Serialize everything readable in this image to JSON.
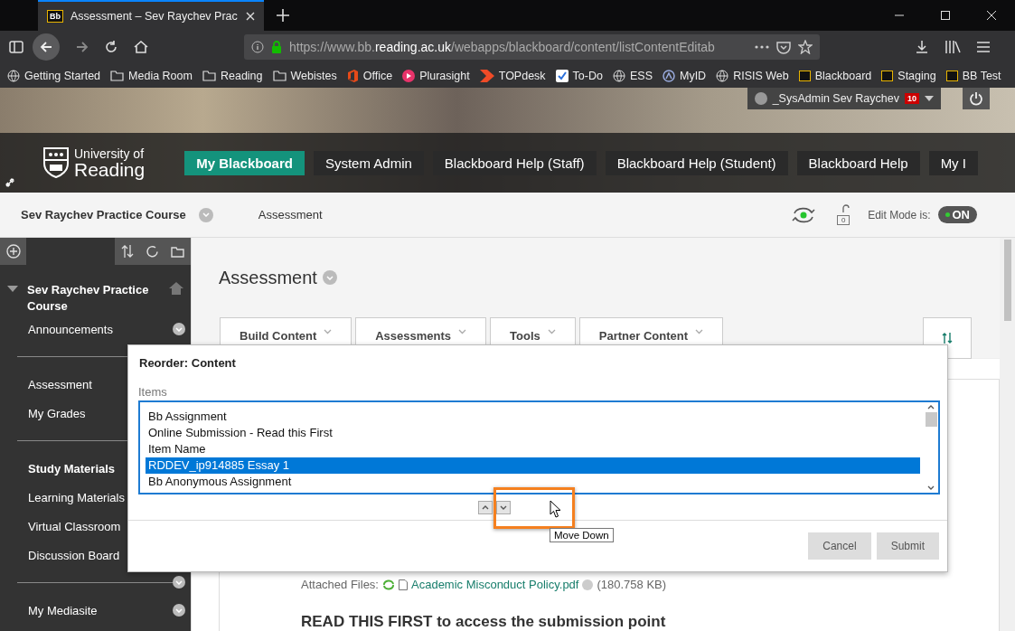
{
  "browser": {
    "tab_icon": "Bb",
    "tab_title": "Assessment – Sev Raychev Prac",
    "url": {
      "prefix": "https://www.bb.",
      "domain": "reading.ac.uk",
      "path": "/webapps/blackboard/content/listContentEditab"
    },
    "bookmarks": [
      {
        "label": "Getting Started",
        "kind": "globe"
      },
      {
        "label": "Media Room",
        "kind": "folder"
      },
      {
        "label": "Reading",
        "kind": "folder"
      },
      {
        "label": "Webistes",
        "kind": "folder"
      },
      {
        "label": "Office",
        "kind": "office"
      },
      {
        "label": "Plurasight",
        "kind": "play"
      },
      {
        "label": "TOPdesk",
        "kind": "arrow"
      },
      {
        "label": "To-Do",
        "kind": "check"
      },
      {
        "label": "ESS",
        "kind": "globe"
      },
      {
        "label": "MyID",
        "kind": "ring"
      },
      {
        "label": "RISIS Web",
        "kind": "globe"
      },
      {
        "label": "Blackboard",
        "kind": "bb"
      },
      {
        "label": "Staging",
        "kind": "bb"
      },
      {
        "label": "BB Test",
        "kind": "bb"
      }
    ]
  },
  "header": {
    "user": "_SysAdmin Sev Raychev",
    "notification_count": "10",
    "logo": [
      "University of",
      "Reading"
    ],
    "tabs": [
      {
        "label": "My Blackboard",
        "selected": true
      },
      {
        "label": "System Admin",
        "selected": false
      },
      {
        "label": "Blackboard Help (Staff)",
        "selected": false
      },
      {
        "label": "Blackboard Help (Student)",
        "selected": false
      },
      {
        "label": "Blackboard Help",
        "selected": false
      },
      {
        "label": "My I",
        "selected": false
      }
    ]
  },
  "course_bar": {
    "course": "Sev Raychev Practice Course",
    "breadcrumb": "Assessment",
    "edit_mode_label": "Edit Mode is:",
    "edit_mode": {
      "on": true,
      "label": "ON"
    },
    "lock_count": "0"
  },
  "sidebar": {
    "items": [
      {
        "kind": "course",
        "label": "Sev Raychev Practice Course"
      },
      {
        "kind": "link",
        "label": "Announcements",
        "menu": true
      },
      {
        "kind": "divider"
      },
      {
        "kind": "link",
        "label": "Assessment",
        "menu": false
      },
      {
        "kind": "link",
        "label": "My Grades",
        "menu": false
      },
      {
        "kind": "divider"
      },
      {
        "kind": "heading",
        "label": "Study Materials"
      },
      {
        "kind": "link",
        "label": "Learning Materials",
        "menu": false
      },
      {
        "kind": "link",
        "label": "Virtual Classroom",
        "menu": false
      },
      {
        "kind": "link",
        "label": "Discussion Board",
        "menu": false
      },
      {
        "kind": "divider",
        "menu": true
      },
      {
        "kind": "link",
        "label": "My Mediasite",
        "menu": true
      }
    ]
  },
  "main": {
    "title": "Assessment",
    "action_buttons": [
      "Build Content",
      "Assessments",
      "Tools",
      "Partner Content"
    ],
    "attached_label": "Attached Files:",
    "file_name": "Academic Misconduct Policy.pdf",
    "file_size": "(180.758 KB)",
    "heading": "READ THIS FIRST to access the submission point"
  },
  "modal": {
    "title": "Reorder: Content",
    "list_label": "Items",
    "items": [
      {
        "label": "Bb Assignment",
        "selected": false
      },
      {
        "label": "Online Submission - Read this First",
        "selected": false
      },
      {
        "label": "Item Name",
        "selected": false
      },
      {
        "label": "RDDEV_ip914885 Essay 1",
        "selected": true
      },
      {
        "label": "Bb Anonymous Assignment",
        "selected": false
      }
    ],
    "tooltip": "Move Down",
    "buttons": [
      "Cancel",
      "Submit"
    ]
  }
}
